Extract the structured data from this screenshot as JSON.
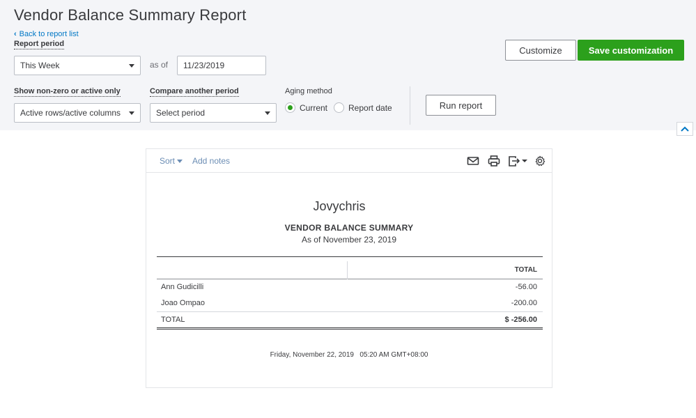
{
  "page": {
    "title": "Vendor Balance Summary Report",
    "back_link": "Back to report list"
  },
  "filters": {
    "report_period_label": "Report period",
    "report_period_value": "This Week",
    "as_of_label": "as of",
    "date_value": "11/23/2019",
    "show_label": "Show non-zero or active only",
    "show_value": "Active rows/active columns",
    "compare_label": "Compare another period",
    "compare_value": "Select period",
    "aging_label": "Aging method",
    "aging_options": [
      {
        "label": "Current",
        "selected": true
      },
      {
        "label": "Report date",
        "selected": false
      }
    ],
    "run_button": "Run report"
  },
  "actions": {
    "customize": "Customize",
    "save_customization": "Save customization"
  },
  "report": {
    "toolbar": {
      "sort": "Sort",
      "add_notes": "Add notes",
      "icons": [
        "email-icon",
        "print-icon",
        "export-icon",
        "settings-icon"
      ]
    },
    "company": "Jovychris",
    "title": "VENDOR BALANCE SUMMARY",
    "subtitle": "As of November 23, 2019",
    "column_header": "TOTAL",
    "rows": [
      {
        "name": "Ann Gudicilli",
        "amount": "-56.00"
      },
      {
        "name": "Joao Ompao",
        "amount": "-200.00"
      }
    ],
    "total": {
      "name": "TOTAL",
      "amount": "$ -256.00"
    },
    "timestamp": "Friday, November 22, 2019   05:20 AM GMT+08:00"
  },
  "colors": {
    "accent_green": "#2ca01c",
    "link_blue": "#0077c5",
    "header_bg": "#f4f5f8"
  }
}
